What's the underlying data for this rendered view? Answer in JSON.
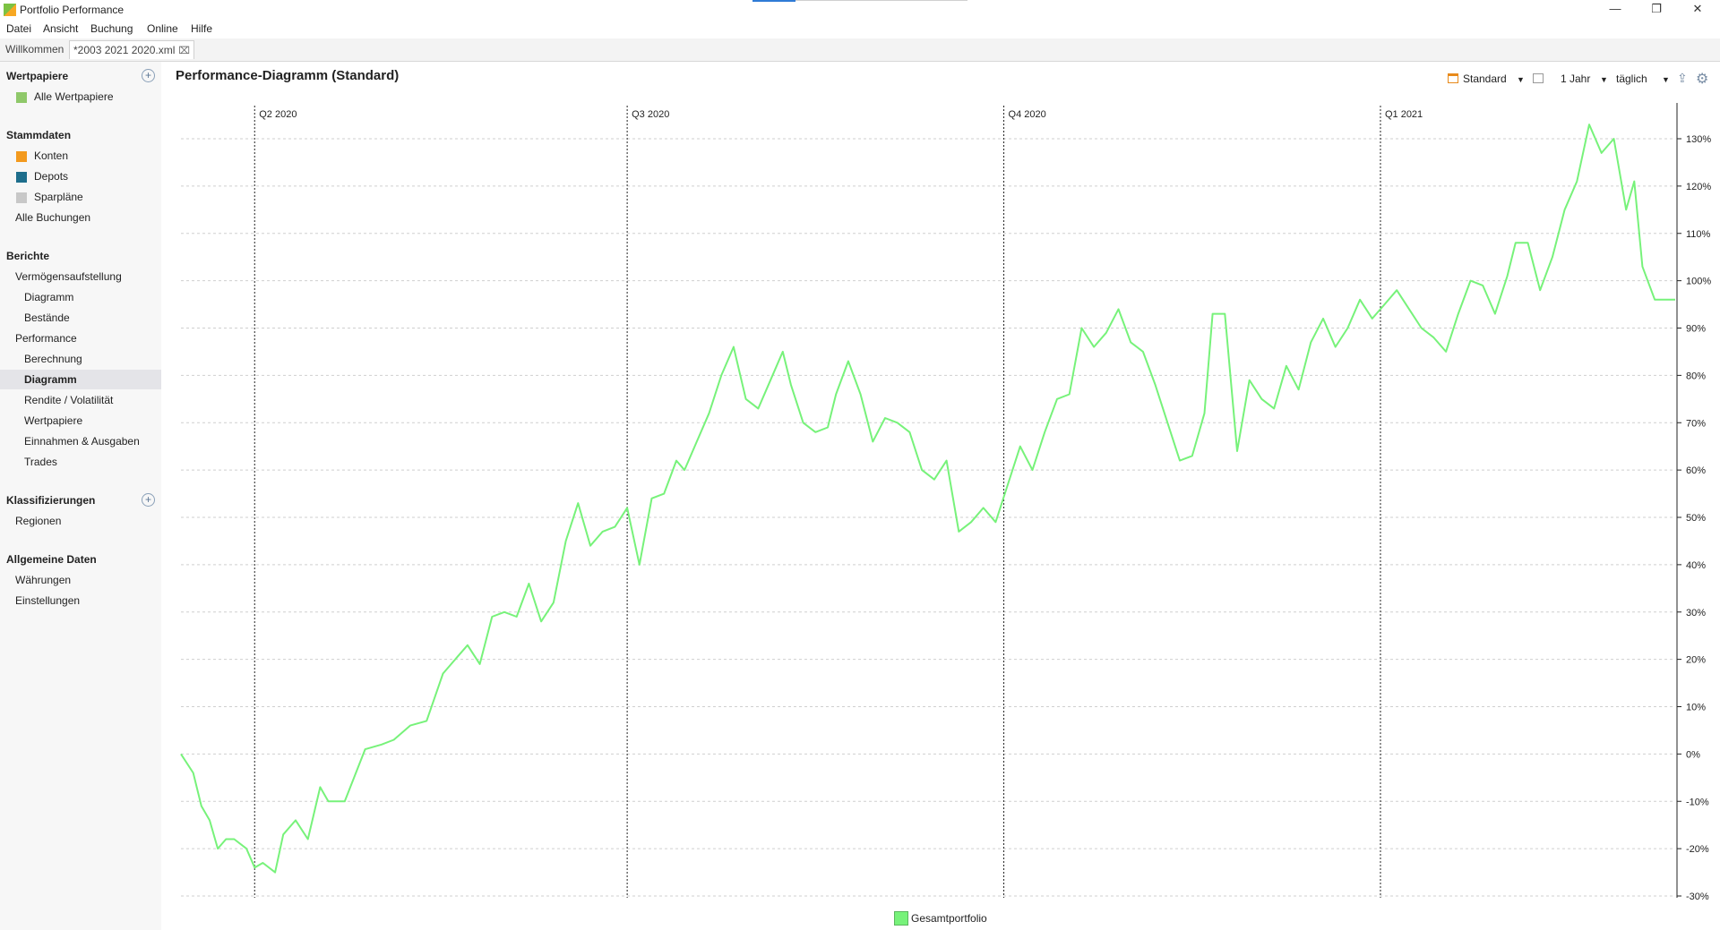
{
  "window": {
    "title": "Portfolio Performance"
  },
  "menu": [
    "Datei",
    "Ansicht",
    "Buchung",
    "Online",
    "Hilfe"
  ],
  "tabs": [
    {
      "label": "Willkommen"
    },
    {
      "label": "*2003 2021 2020.xml"
    }
  ],
  "sidebar": {
    "wertpapiere": {
      "title": "Wertpapiere",
      "items": [
        "Alle Wertpapiere"
      ]
    },
    "stammdaten": {
      "title": "Stammdaten",
      "items": [
        "Konten",
        "Depots",
        "Sparpläne",
        "Alle Buchungen"
      ]
    },
    "berichte": {
      "title": "Berichte",
      "items": [
        "Vermögensaufstellung",
        "Diagramm",
        "Bestände",
        "Performance",
        "Berechnung",
        "Diagramm",
        "Rendite / Volatilität",
        "Wertpapiere",
        "Einnahmen & Ausgaben",
        "Trades"
      ]
    },
    "klassifizierungen": {
      "title": "Klassifizierungen",
      "items": [
        "Regionen"
      ]
    },
    "allgemein": {
      "title": "Allgemeine Daten",
      "items": [
        "Währungen",
        "Einstellungen"
      ]
    }
  },
  "main": {
    "title": "Performance-Diagramm (Standard)",
    "toolbar": {
      "config": "Standard",
      "period": "1 Jahr",
      "interval": "täglich"
    }
  },
  "colors": {
    "series": "#77f27a",
    "selection": "#e4e4e8"
  },
  "chart_data": {
    "type": "line",
    "quarter_labels": [
      "Q2 2020",
      "Q3 2020",
      "Q4 2020",
      "Q1 2021"
    ],
    "quarter_starts": [
      "2020-04-01",
      "2020-07-01",
      "2020-10-01",
      "2021-01-01"
    ],
    "x_range": [
      "2020-03-14",
      "2021-03-14"
    ],
    "ylim": [
      -30,
      130
    ],
    "ytick_labels": [
      "130%",
      "120%",
      "110%",
      "100%",
      "90%",
      "80%",
      "70%",
      "60%",
      "50%",
      "40%",
      "30%",
      "20%",
      "10%",
      "0%",
      "-10%",
      "-20%",
      "-30%"
    ],
    "grid": true,
    "legend_position": "bottom-center",
    "series": [
      {
        "name": "Gesamtportfolio",
        "points": [
          [
            "2020-03-14",
            0
          ],
          [
            "2020-03-17",
            -4
          ],
          [
            "2020-03-19",
            -11
          ],
          [
            "2020-03-21",
            -14
          ],
          [
            "2020-03-23",
            -20
          ],
          [
            "2020-03-25",
            -18
          ],
          [
            "2020-03-27",
            -18
          ],
          [
            "2020-03-30",
            -20
          ],
          [
            "2020-04-01",
            -24
          ],
          [
            "2020-04-03",
            -23
          ],
          [
            "2020-04-06",
            -25
          ],
          [
            "2020-04-08",
            -17
          ],
          [
            "2020-04-11",
            -14
          ],
          [
            "2020-04-14",
            -18
          ],
          [
            "2020-04-17",
            -7
          ],
          [
            "2020-04-19",
            -10
          ],
          [
            "2020-04-23",
            -10
          ],
          [
            "2020-04-28",
            1
          ],
          [
            "2020-05-02",
            2
          ],
          [
            "2020-05-05",
            3
          ],
          [
            "2020-05-09",
            6
          ],
          [
            "2020-05-13",
            7
          ],
          [
            "2020-05-17",
            17
          ],
          [
            "2020-05-20",
            20
          ],
          [
            "2020-05-23",
            23
          ],
          [
            "2020-05-26",
            19
          ],
          [
            "2020-05-29",
            29
          ],
          [
            "2020-06-01",
            30
          ],
          [
            "2020-06-04",
            29
          ],
          [
            "2020-06-07",
            36
          ],
          [
            "2020-06-10",
            28
          ],
          [
            "2020-06-13",
            32
          ],
          [
            "2020-06-16",
            45
          ],
          [
            "2020-06-19",
            53
          ],
          [
            "2020-06-22",
            44
          ],
          [
            "2020-06-25",
            47
          ],
          [
            "2020-06-28",
            48
          ],
          [
            "2020-07-01",
            52
          ],
          [
            "2020-07-04",
            40
          ],
          [
            "2020-07-07",
            54
          ],
          [
            "2020-07-10",
            55
          ],
          [
            "2020-07-13",
            62
          ],
          [
            "2020-07-15",
            60
          ],
          [
            "2020-07-18",
            66
          ],
          [
            "2020-07-21",
            72
          ],
          [
            "2020-07-24",
            80
          ],
          [
            "2020-07-27",
            86
          ],
          [
            "2020-07-30",
            75
          ],
          [
            "2020-08-02",
            73
          ],
          [
            "2020-08-05",
            79
          ],
          [
            "2020-08-08",
            85
          ],
          [
            "2020-08-10",
            78
          ],
          [
            "2020-08-13",
            70
          ],
          [
            "2020-08-16",
            68
          ],
          [
            "2020-08-19",
            69
          ],
          [
            "2020-08-21",
            76
          ],
          [
            "2020-08-24",
            83
          ],
          [
            "2020-08-27",
            76
          ],
          [
            "2020-08-30",
            66
          ],
          [
            "2020-09-02",
            71
          ],
          [
            "2020-09-05",
            70
          ],
          [
            "2020-09-08",
            68
          ],
          [
            "2020-09-11",
            60
          ],
          [
            "2020-09-14",
            58
          ],
          [
            "2020-09-17",
            62
          ],
          [
            "2020-09-20",
            47
          ],
          [
            "2020-09-23",
            49
          ],
          [
            "2020-09-26",
            52
          ],
          [
            "2020-09-29",
            49
          ],
          [
            "2020-10-02",
            57
          ],
          [
            "2020-10-05",
            65
          ],
          [
            "2020-10-08",
            60
          ],
          [
            "2020-10-11",
            68
          ],
          [
            "2020-10-14",
            75
          ],
          [
            "2020-10-17",
            76
          ],
          [
            "2020-10-20",
            90
          ],
          [
            "2020-10-23",
            86
          ],
          [
            "2020-10-26",
            89
          ],
          [
            "2020-10-29",
            94
          ],
          [
            "2020-11-01",
            87
          ],
          [
            "2020-11-04",
            85
          ],
          [
            "2020-11-07",
            78
          ],
          [
            "2020-11-10",
            70
          ],
          [
            "2020-11-13",
            62
          ],
          [
            "2020-11-16",
            63
          ],
          [
            "2020-11-19",
            72
          ],
          [
            "2020-11-21",
            93
          ],
          [
            "2020-11-24",
            93
          ],
          [
            "2020-11-27",
            64
          ],
          [
            "2020-11-30",
            79
          ],
          [
            "2020-12-03",
            75
          ],
          [
            "2020-12-06",
            73
          ],
          [
            "2020-12-09",
            82
          ],
          [
            "2020-12-12",
            77
          ],
          [
            "2020-12-15",
            87
          ],
          [
            "2020-12-18",
            92
          ],
          [
            "2020-12-21",
            86
          ],
          [
            "2020-12-24",
            90
          ],
          [
            "2020-12-27",
            96
          ],
          [
            "2020-12-30",
            92
          ],
          [
            "2021-01-02",
            95
          ],
          [
            "2021-01-05",
            98
          ],
          [
            "2021-01-08",
            94
          ],
          [
            "2021-01-11",
            90
          ],
          [
            "2021-01-14",
            88
          ],
          [
            "2021-01-17",
            85
          ],
          [
            "2021-01-20",
            93
          ],
          [
            "2021-01-23",
            100
          ],
          [
            "2021-01-26",
            99
          ],
          [
            "2021-01-29",
            93
          ],
          [
            "2021-02-01",
            101
          ],
          [
            "2021-02-03",
            108
          ],
          [
            "2021-02-06",
            108
          ],
          [
            "2021-02-09",
            98
          ],
          [
            "2021-02-12",
            105
          ],
          [
            "2021-02-15",
            115
          ],
          [
            "2021-02-18",
            121
          ],
          [
            "2021-02-21",
            133
          ],
          [
            "2021-02-24",
            127
          ],
          [
            "2021-02-27",
            130
          ],
          [
            "2021-03-02",
            115
          ],
          [
            "2021-03-04",
            121
          ],
          [
            "2021-03-06",
            103
          ],
          [
            "2021-03-09",
            96
          ],
          [
            "2021-03-14",
            96
          ]
        ]
      }
    ]
  }
}
